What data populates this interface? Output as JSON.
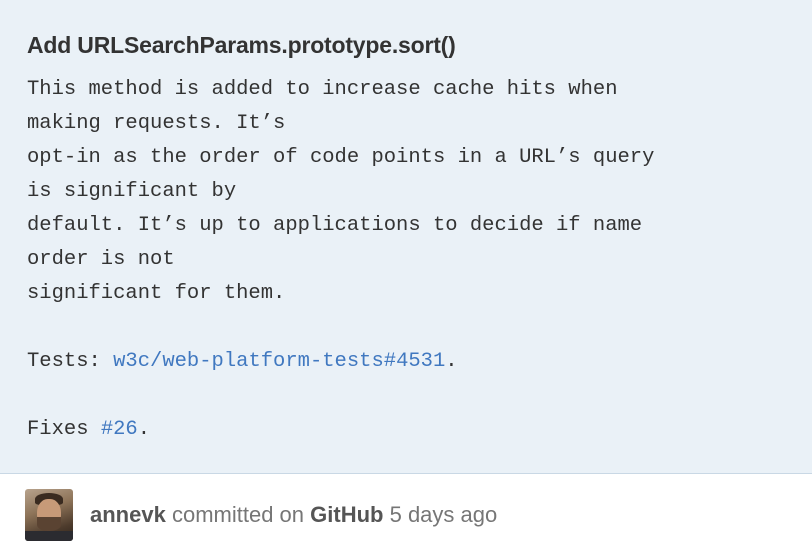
{
  "commit": {
    "title": "Add URLSearchParams.prototype.sort()",
    "description": {
      "line1": "This method is added to increase cache hits when",
      "line2": "making requests. It’s",
      "line3": "opt-in as the order of code points in a URL’s query",
      "line4": "is significant by",
      "line5": "default. It’s up to applications to decide if name",
      "line6": "order is not",
      "line7": "significant for them.",
      "tests_prefix": "Tests: ",
      "tests_link": "w3c/web-platform-tests#4531",
      "tests_suffix": ".",
      "fixes_prefix": "Fixes ",
      "fixes_link": "#26",
      "fixes_suffix": "."
    }
  },
  "meta": {
    "author": "annevk",
    "committed_on": "committed on",
    "committer": "GitHub",
    "time": "5 days ago"
  },
  "colors": {
    "box_background": "#eaf1f7",
    "link": "#4078c0",
    "text": "#333333",
    "muted": "#767676"
  }
}
